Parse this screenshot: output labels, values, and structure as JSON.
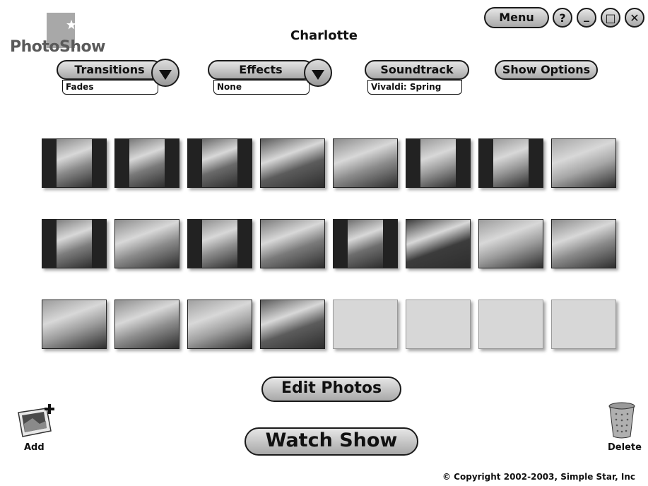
{
  "app": {
    "logo_text": "PhotoShow",
    "title": "Charlotte",
    "copyright": "© Copyright 2002-2003, Simple Star, Inc"
  },
  "window_controls": {
    "menu_label": "Menu",
    "help_glyph": "?",
    "minimize_glyph": "_",
    "maximize_glyph": "□",
    "close_glyph": "✕"
  },
  "controls": {
    "transitions": {
      "label": "Transitions",
      "value": "Fades"
    },
    "effects": {
      "label": "Effects",
      "value": "None"
    },
    "soundtrack": {
      "label": "Soundtrack",
      "value": "Vivaldi: Spring"
    },
    "show_options": {
      "label": "Show Options"
    }
  },
  "photo_grid": {
    "rows": [
      [
        {
          "kind": "portrait",
          "tone": "#8a8a8a"
        },
        {
          "kind": "portrait",
          "tone": "#7a7a7a"
        },
        {
          "kind": "portrait",
          "tone": "#6a6a6a"
        },
        {
          "kind": "landscape",
          "tone": "#5c5c5c"
        },
        {
          "kind": "landscape",
          "tone": "#8c8c8c"
        },
        {
          "kind": "portrait",
          "tone": "#9a9a9a"
        },
        {
          "kind": "portrait",
          "tone": "#9a9a9a"
        },
        {
          "kind": "landscape",
          "tone": "#a6a6a6"
        }
      ],
      [
        {
          "kind": "portrait",
          "tone": "#7e7e7e"
        },
        {
          "kind": "landscape",
          "tone": "#8a8a8a"
        },
        {
          "kind": "portrait",
          "tone": "#8e8e8e"
        },
        {
          "kind": "landscape",
          "tone": "#7a7a7a"
        },
        {
          "kind": "portrait",
          "tone": "#6e6e6e"
        },
        {
          "kind": "landscape",
          "tone": "#3c3c3c"
        },
        {
          "kind": "landscape",
          "tone": "#9c9c9c"
        },
        {
          "kind": "landscape",
          "tone": "#8a8a8a"
        }
      ],
      [
        {
          "kind": "landscape",
          "tone": "#9c9c9c"
        },
        {
          "kind": "landscape",
          "tone": "#8e8e8e"
        },
        {
          "kind": "landscape",
          "tone": "#a0a0a0"
        },
        {
          "kind": "landscape",
          "tone": "#5c5c5c"
        },
        {
          "kind": "empty"
        },
        {
          "kind": "empty"
        },
        {
          "kind": "empty"
        },
        {
          "kind": "empty"
        }
      ]
    ]
  },
  "actions": {
    "edit_photos": "Edit Photos",
    "watch_show": "Watch Show",
    "add": "Add",
    "delete": "Delete"
  },
  "icons": {
    "add": "add-photos-icon",
    "delete": "trash-can-icon"
  }
}
